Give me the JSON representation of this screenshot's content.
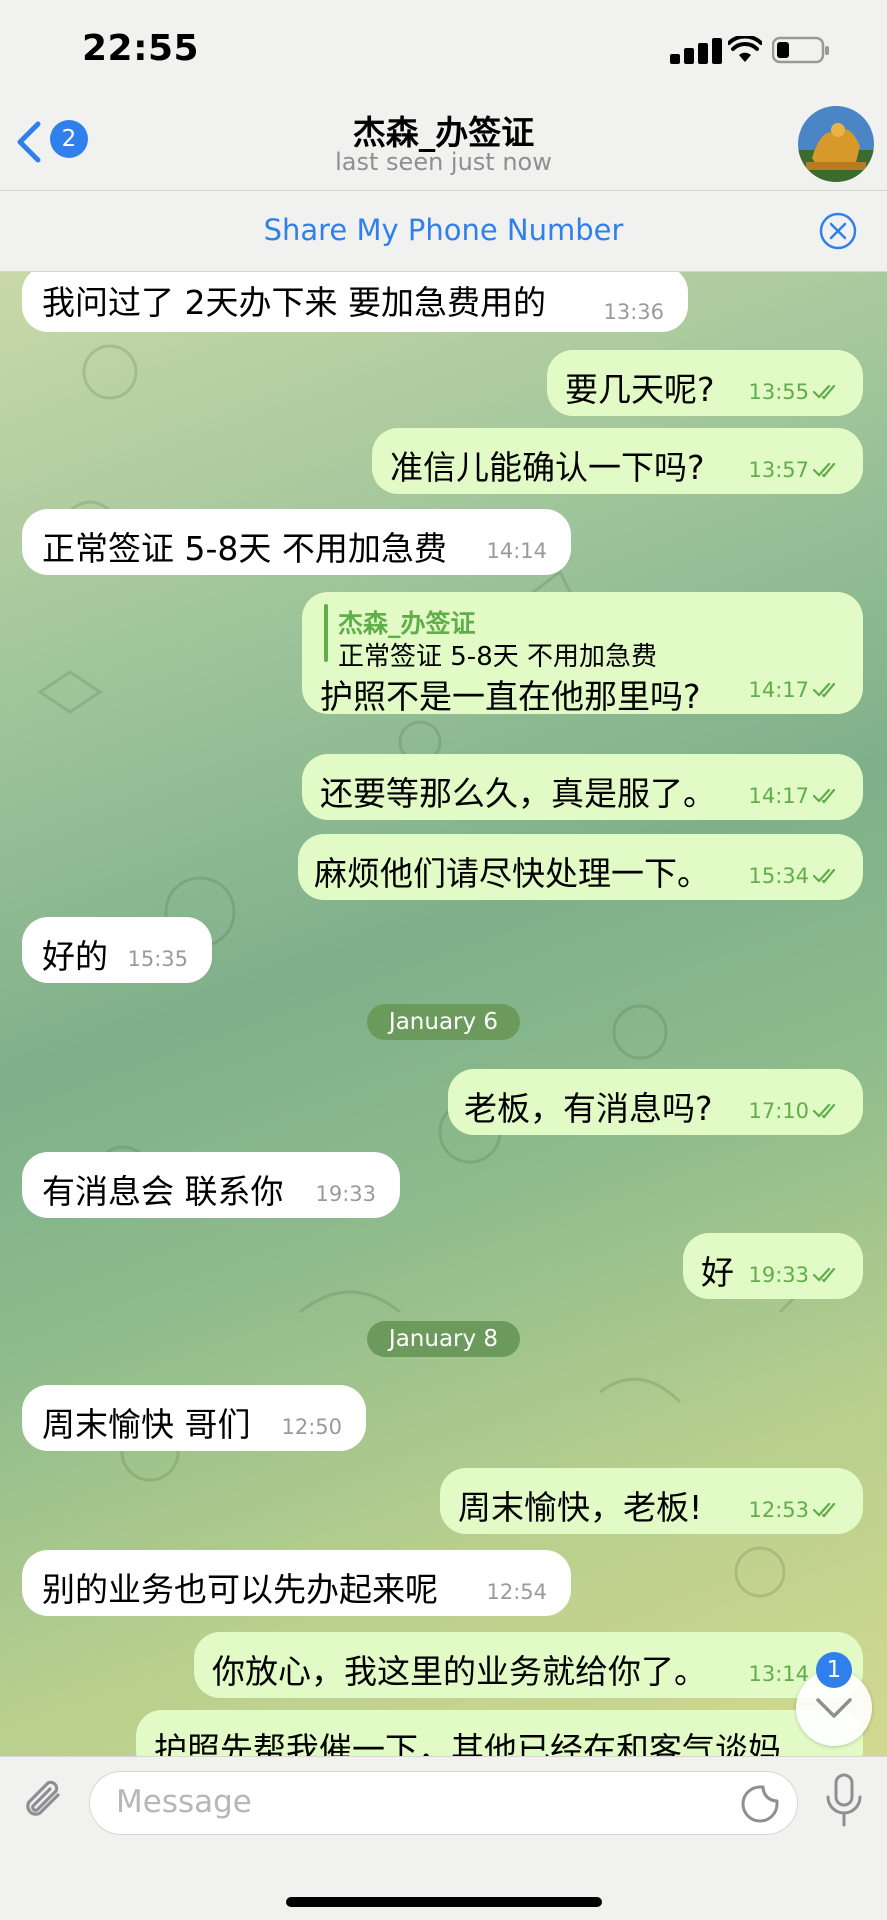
{
  "status_bar": {
    "time": "22:55"
  },
  "header": {
    "title": "杰森_办签证",
    "subtitle": "last seen just now",
    "back_badge": "2"
  },
  "share_bar": {
    "label": "Share My Phone Number"
  },
  "messages": [
    {
      "dir": "in",
      "text": "我问过了 2天办下来 要加急费用的",
      "time": "13:36"
    },
    {
      "dir": "out",
      "text": "要几天呢?",
      "time": "13:55"
    },
    {
      "dir": "out",
      "text": "准信儿能确认一下吗?",
      "time": "13:57"
    },
    {
      "dir": "in",
      "text": "正常签证 5-8天 不用加急费",
      "time": "14:14"
    },
    {
      "dir": "out",
      "text": "护照不是一直在他那里吗?",
      "time": "14:17",
      "reply": {
        "author": "杰森_办签证",
        "text": "正常签证 5-8天 不用加急费"
      }
    },
    {
      "dir": "out",
      "text": "还要等那么久，真是服了。",
      "time": "14:17"
    },
    {
      "dir": "out",
      "text": "麻烦他们请尽快处理一下。",
      "time": "15:34"
    },
    {
      "dir": "in",
      "text": "好的",
      "time": "15:35"
    },
    {
      "dir": "out",
      "text": "老板，有消息吗?",
      "time": "17:10"
    },
    {
      "dir": "in",
      "text": "有消息会 联系你",
      "time": "19:33"
    },
    {
      "dir": "out",
      "text": "好",
      "time": "19:33"
    },
    {
      "dir": "in",
      "text": "周末愉快 哥们",
      "time": "12:50"
    },
    {
      "dir": "out",
      "text": "周末愉快，老板!",
      "time": "12:53"
    },
    {
      "dir": "in",
      "text": "别的业务也可以先办起来呢",
      "time": "12:54"
    },
    {
      "dir": "out",
      "text": "你放心，我这里的业务就给你了。",
      "time": "13:14"
    },
    {
      "dir": "out",
      "text": "护照先帮我催一下，其他已经在和客气谈妈",
      "time": ""
    }
  ],
  "date_separators": [
    "January 6",
    "January 8"
  ],
  "scroll_down_badge": "1",
  "input": {
    "placeholder": "Message"
  },
  "icons": {
    "back": "chevron-left-icon",
    "close": "close-circle-icon",
    "attach": "paperclip-icon",
    "sticker": "sticker-icon",
    "mic": "microphone-icon",
    "scroll": "chevron-down-icon"
  },
  "colors": {
    "accent": "#2f80ed",
    "outgoing_bubble": "#e2fbc6",
    "incoming_bubble": "#ffffff",
    "read_check": "#5fae4a"
  }
}
